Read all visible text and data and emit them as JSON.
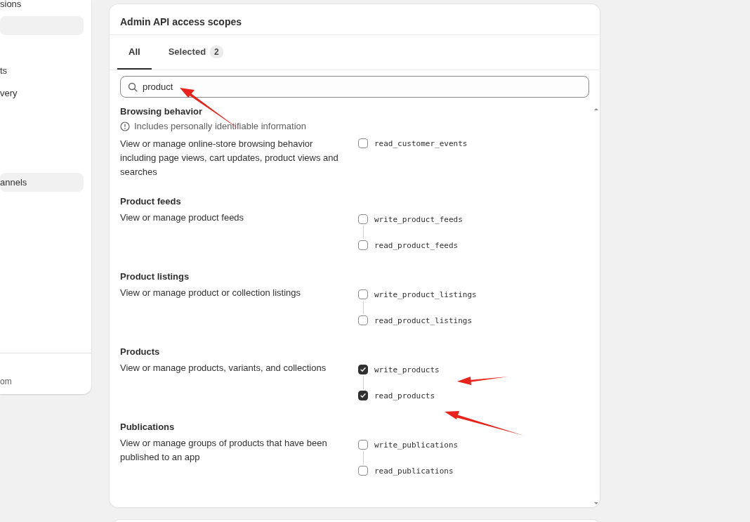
{
  "sidebar": {
    "items": [
      {
        "label": "sions",
        "selected": false
      },
      {
        "selected": true
      },
      {
        "label": "ts",
        "selected": false
      },
      {
        "label": "very",
        "selected": false
      },
      {
        "label": "annels",
        "selected": true
      }
    ],
    "footer": "om"
  },
  "card": {
    "title": "Admin API access scopes",
    "tabs": [
      {
        "label": "All",
        "selected": true
      },
      {
        "label": "Selected",
        "count": "2",
        "selected": false
      }
    ],
    "search": {
      "value": "product"
    },
    "groups": [
      {
        "title": "Browsing behavior",
        "warning": "Includes personally identifiable information",
        "description": "View or manage online-store browsing behavior including page views, cart updates, product views and searches",
        "scopes": [
          {
            "name": "read_customer_events",
            "checked": false
          }
        ]
      },
      {
        "title": "Product feeds",
        "description": "View or manage product feeds",
        "scopes": [
          {
            "name": "write_product_feeds",
            "checked": false
          },
          {
            "name": "read_product_feeds",
            "checked": false
          }
        ]
      },
      {
        "title": "Product listings",
        "description": "View or manage product or collection listings",
        "scopes": [
          {
            "name": "write_product_listings",
            "checked": false
          },
          {
            "name": "read_product_listings",
            "checked": false
          }
        ]
      },
      {
        "title": "Products",
        "description": "View or manage products, variants, and collections",
        "scopes": [
          {
            "name": "write_products",
            "checked": true
          },
          {
            "name": "read_products",
            "checked": true
          }
        ]
      },
      {
        "title": "Publications",
        "description": "View or manage groups of products that have been published to an app",
        "scopes": [
          {
            "name": "write_publications",
            "checked": false
          },
          {
            "name": "read_publications",
            "checked": false
          }
        ]
      }
    ]
  }
}
